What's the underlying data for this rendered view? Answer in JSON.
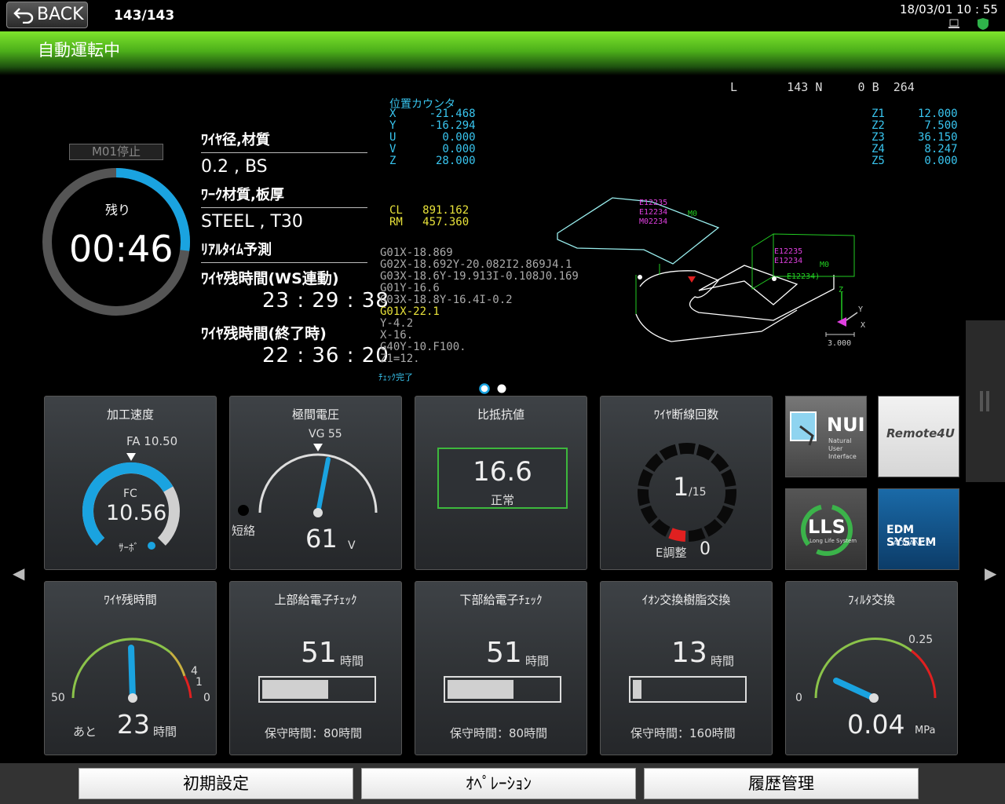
{
  "topbar": {
    "back_label": "BACK",
    "page_counter": "143/143",
    "datetime": "18/03/01 10 : 55"
  },
  "mode": {
    "title": "自動運転中"
  },
  "timer": {
    "status_badge": "M01停止",
    "remain_label": "残り",
    "remain_time": "00:46",
    "progress_fraction": 0.27
  },
  "info": {
    "wire_label": "ﾜｲﾔ径,材質",
    "wire_value": "0.2 , BS",
    "work_label": "ﾜｰｸ材質,板厚",
    "work_value": "STEEL , T30",
    "realtime_label": "ﾘｱﾙﾀｲﾑ予測",
    "ws_label": "ﾜｲﾔ残時間(WS連動)",
    "ws_value": "23 : 29 : 38",
    "end_label": "ﾜｲﾔ残時間(終了時)",
    "end_value": "22 : 36 : 20"
  },
  "cnc": {
    "header": "L       143 N     0 B  264",
    "pos_title": "位置カウンタ",
    "axes": [
      {
        "n": "X",
        "v": "-21.468"
      },
      {
        "n": "Y",
        "v": "-16.294"
      },
      {
        "n": "U",
        "v": "0.000"
      },
      {
        "n": "V",
        "v": "0.000"
      },
      {
        "n": "Z",
        "v": "28.000"
      }
    ],
    "zaxes": [
      {
        "n": "Z1",
        "v": "12.000"
      },
      {
        "n": "Z2",
        "v": "7.500"
      },
      {
        "n": "Z3",
        "v": "36.150"
      },
      {
        "n": "Z4",
        "v": "8.247"
      },
      {
        "n": "Z5",
        "v": "0.000"
      }
    ],
    "cl": "CL   891.162",
    "rm": "RM   457.360",
    "program": [
      "G01X-18.869",
      "G02X-18.692Y-20.082I2.869J4.1",
      "G03X-18.6Y-19.913I-0.108J0.169",
      "G01Y-16.6",
      "G03X-18.8Y-16.4I-0.2",
      "G01X-22.1",
      "Y-4.2",
      "X-16.",
      "G40Y-10.F100.",
      "Z1=12."
    ],
    "check": "ﾁｪｯｸ完了",
    "scale": "3.000",
    "labels": [
      "E12235",
      "E12234",
      "M02234",
      "E12234)",
      "M0",
      "Y",
      "X",
      "Z"
    ]
  },
  "tiles": {
    "speed": {
      "title": "加工速度",
      "fa": "FA 10.50",
      "fc_label": "FC",
      "fc_value": "10.56",
      "servo": "ｻｰﾎﾞ",
      "fill_fraction": 0.72
    },
    "voltage": {
      "title": "極間電圧",
      "vg": "VG  55",
      "short": "短絡",
      "value": "61",
      "unit": "V"
    },
    "resist": {
      "title": "比抵抗値",
      "value": "16.6",
      "status": "正常"
    },
    "wirebreak": {
      "title": "ﾜｲﾔ断線回数",
      "count": "1",
      "total": "/15",
      "e_label": "E調整",
      "e_value": "0"
    },
    "wireremain": {
      "title": "ﾜｲﾔ残時間",
      "s50": "50",
      "s4": "4",
      "s1": "1",
      "s0": "0",
      "prefix": "あと",
      "value": "23",
      "unit": "時間"
    },
    "upper": {
      "title": "上部給電子ﾁｪｯｸ",
      "value": "51",
      "unit": "時間",
      "maint": "保守時間：80時間",
      "fill_fraction": 0.6
    },
    "lower": {
      "title": "下部給電子ﾁｪｯｸ",
      "value": "51",
      "unit": "時間",
      "maint": "保守時間：80時間",
      "fill_fraction": 0.6
    },
    "ion": {
      "title": "ｲｵﾝ交換樹脂交換",
      "value": "13",
      "unit": "時間",
      "maint": "保守時間：160時間",
      "fill_fraction": 0.08
    },
    "filter": {
      "title": "ﾌｨﾙﾀ交換",
      "s0": "0",
      "s025": "0.25",
      "value": "0.04",
      "unit": "MPa"
    }
  },
  "apps": {
    "nui": "NUI",
    "nui_sub": "Natural User Interface",
    "remote": "Remote4U",
    "lls": "LLS",
    "lls_sub": "Long Life System",
    "edm": "EDM SYSTEM",
    "edm_sub": "ADVANCE"
  },
  "footer": {
    "b1": "初期設定",
    "b2": "ｵﾍﾟﾚｰｼｮﾝ",
    "b3": "履歴管理"
  }
}
